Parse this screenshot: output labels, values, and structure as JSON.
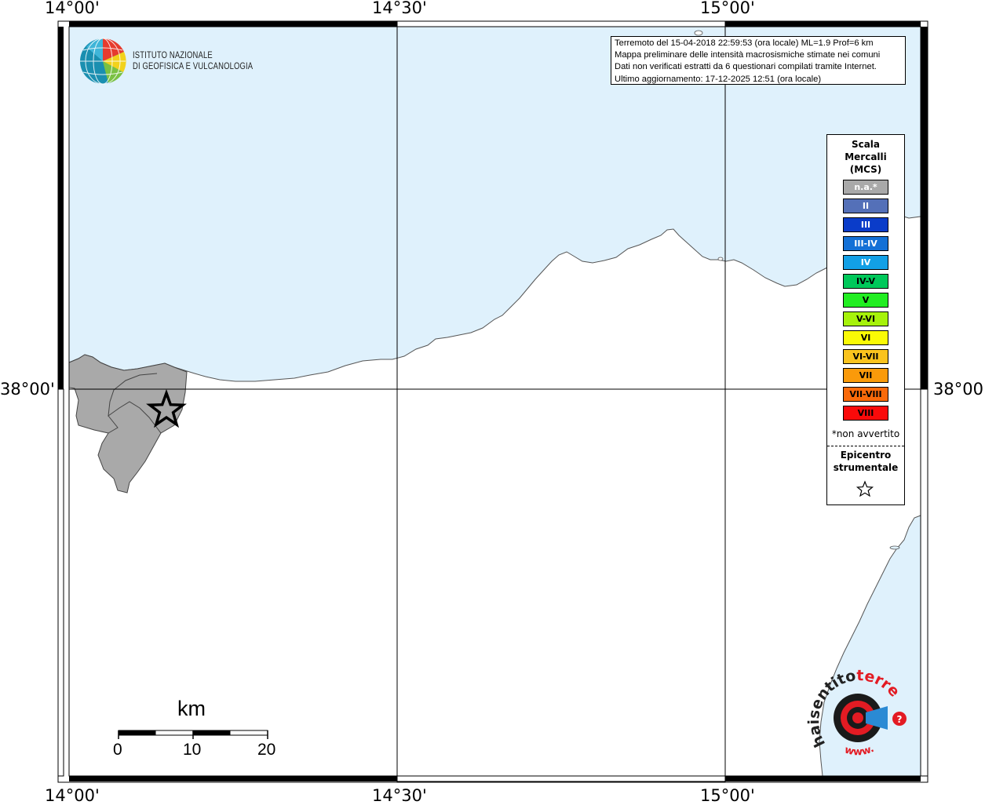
{
  "map": {
    "coords": {
      "top_left": "14°00'",
      "top_mid": "14°30'",
      "top_right": "15°00'",
      "bottom_left": "14°00'",
      "bottom_mid": "14°30'",
      "bottom_right": "15°00'",
      "left_lat": "38°00'",
      "right_lat": "38°00'"
    },
    "colors": {
      "sea": "#dff1fc",
      "land": "#ffffff",
      "felt_area": "#a9a9a9",
      "frame": "#000000"
    },
    "epicenter_icon": "star-icon"
  },
  "logo": {
    "icon": "globe-logo-icon",
    "line1": "ISTITUTO NAZIONALE",
    "line2": "DI GEOFISICA E VULCANOLOGIA"
  },
  "info": {
    "line1": "Terremoto del 15-04-2018 22:59:53 (ora locale) ML=1.9 Prof=6 km",
    "line2": "Mappa preliminare delle intensità macrosismiche stimate nei comuni",
    "line3": "Dati non verificati estratti da 6 questionari compilati tramite Internet.",
    "line4": "Ultimo aggiornamento: 17-12-2025 12:51 (ora locale)"
  },
  "legend": {
    "title1": "Scala",
    "title2": "Mercalli",
    "title3": "(MCS)",
    "items": [
      {
        "label": "n.a.*",
        "color": "#a9a9a9",
        "text_color": "#ffffff"
      },
      {
        "label": "II",
        "color": "#5470b8",
        "text_color": "#ffffff"
      },
      {
        "label": "III",
        "color": "#0a3cc9",
        "text_color": "#ffffff"
      },
      {
        "label": "III-IV",
        "color": "#1370d6",
        "text_color": "#ffffff"
      },
      {
        "label": "IV",
        "color": "#12a0e6",
        "text_color": "#ffffff"
      },
      {
        "label": "IV-V",
        "color": "#00c85a",
        "text_color": "#000000"
      },
      {
        "label": "V",
        "color": "#22ee22",
        "text_color": "#000000"
      },
      {
        "label": "V-VI",
        "color": "#a6f20a",
        "text_color": "#000000"
      },
      {
        "label": "VI",
        "color": "#fafa05",
        "text_color": "#000000"
      },
      {
        "label": "VI-VII",
        "color": "#fac31e",
        "text_color": "#000000"
      },
      {
        "label": "VII",
        "color": "#fa9a0a",
        "text_color": "#000000"
      },
      {
        "label": "VII-VIII",
        "color": "#fa6a0a",
        "text_color": "#000000"
      },
      {
        "label": "VIII",
        "color": "#fa0a0a",
        "text_color": "#000000"
      }
    ],
    "note": "*non avvertito",
    "epi1": "Epicentro",
    "epi2": "strumentale",
    "epi_icon": "star-icon"
  },
  "scalebar": {
    "unit": "km",
    "ticks": [
      "0",
      "10",
      "20"
    ]
  },
  "hsit": {
    "text_top": "terremoto.it",
    "text_left": "haisentito",
    "text_bottom": "www.",
    "icon": "speaker-target-icon"
  }
}
